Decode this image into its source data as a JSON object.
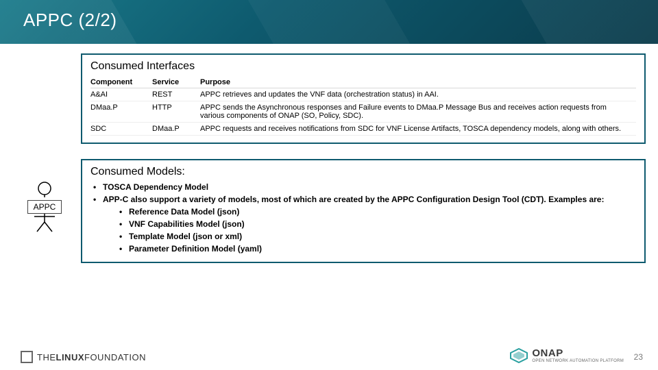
{
  "header": {
    "title": "APPC (2/2)"
  },
  "actor": {
    "label": "APPC"
  },
  "consumed_interfaces": {
    "title": "Consumed Interfaces",
    "columns": [
      "Component",
      "Service",
      "Purpose"
    ],
    "rows": [
      {
        "component": "A&AI",
        "service": "REST",
        "purpose": "APPC retrieves and updates the VNF data (orchestration status) in AAI."
      },
      {
        "component": "DMaa.P",
        "service": "HTTP",
        "purpose": "APPC sends the Asynchronous responses and Failure events to DMaa.P Message Bus and receives action requests from various components of ONAP (SO, Policy, SDC)."
      },
      {
        "component": "SDC",
        "service": "DMaa.P",
        "purpose": "APPC requests and receives notifications from SDC for VNF License Artifacts, TOSCA dependency models,  along with others."
      }
    ]
  },
  "consumed_models": {
    "title": "Consumed Models:",
    "items": [
      {
        "text": "TOSCA Dependency Model"
      },
      {
        "text": "APP-C also support a variety of models, most of which are created by the APPC Configuration Design Tool (CDT).   Examples are:",
        "sub": [
          "Reference Data Model (json)",
          "VNF Capabilities Model (json)",
          "Template Model (json or xml)",
          "Parameter Definition Model (yaml)"
        ]
      }
    ]
  },
  "footer": {
    "linux_foundation": {
      "pre": "THE",
      "mid": "LINUX",
      "post": "FOUNDATION"
    },
    "onap": {
      "name": "ONAP",
      "tagline": "OPEN NETWORK AUTOMATION PLATFORM"
    },
    "page_number": "23"
  }
}
